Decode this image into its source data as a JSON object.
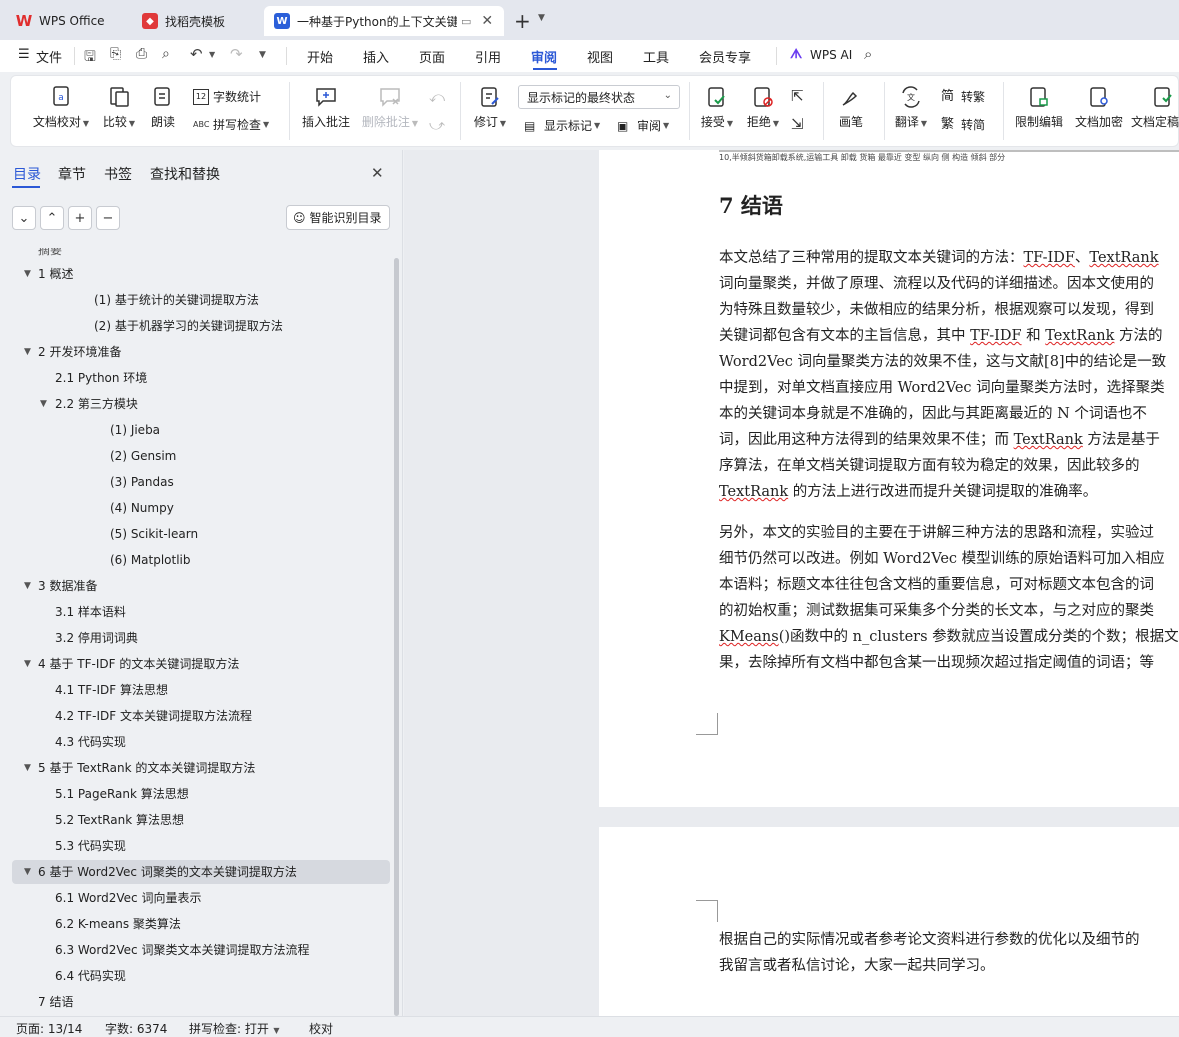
{
  "tabs": {
    "wps": "WPS Office",
    "template": "找稻壳模板",
    "doc": "一种基于Python的上下文关键"
  },
  "menu": {
    "file": "文件",
    "items": [
      "开始",
      "插入",
      "页面",
      "引用",
      "审阅",
      "视图",
      "工具",
      "会员专享"
    ],
    "ai": "WPS AI"
  },
  "ribbon": {
    "proofread": "文档校对",
    "compare": "比较",
    "read_aloud": "朗读",
    "word_count": "字数统计",
    "spell_check": "拼写检查",
    "insert_comment": "插入批注",
    "delete_comment": "删除批注",
    "track_changes": "修订",
    "markup_state": "显示标记的最终状态",
    "show_markup": "显示标记",
    "review": "审阅",
    "accept": "接受",
    "reject": "拒绝",
    "pen": "画笔",
    "translate": "翻译",
    "to_traditional": "转繁",
    "to_simplified": "转简",
    "restrict_edit": "限制编辑",
    "encrypt": "文档加密",
    "finalize": "文档定稿"
  },
  "sidebar": {
    "tabs": [
      "目录",
      "章节",
      "书签",
      "查找和替换"
    ],
    "ai_toc": "智能识别目录",
    "toc": [
      {
        "text": "摘要"
      },
      {
        "text": "1  概述"
      },
      {
        "text": "(1)  基于统计的关键词提取方法"
      },
      {
        "text": "(2)  基于机器学习的关键词提取方法"
      },
      {
        "text": "2  开发环境准备"
      },
      {
        "text": "2.1 Python 环境"
      },
      {
        "text": "2.2  第三方模块"
      },
      {
        "text": "(1)  Jieba"
      },
      {
        "text": "(2)  Gensim"
      },
      {
        "text": "(3)  Pandas"
      },
      {
        "text": "(4)  Numpy"
      },
      {
        "text": "(5)  Scikit-learn"
      },
      {
        "text": "(6)  Matplotlib"
      },
      {
        "text": "3  数据准备"
      },
      {
        "text": "3.1  样本语料"
      },
      {
        "text": "3.2  停用词词典"
      },
      {
        "text": "4  基于 TF-IDF 的文本关键词提取方法"
      },
      {
        "text": "4.1 TF-IDF 算法思想"
      },
      {
        "text": "4.2 TF-IDF 文本关键词提取方法流程"
      },
      {
        "text": "4.3  代码实现"
      },
      {
        "text": "5  基于 TextRank 的文本关键词提取方法"
      },
      {
        "text": "5.1 PageRank 算法思想"
      },
      {
        "text": "5.2 TextRank 算法思想"
      },
      {
        "text": "5.3  代码实现"
      },
      {
        "text": "6  基于 Word2Vec 词聚类的文本关键词提取方法"
      },
      {
        "text": "6.1 Word2Vec 词向量表示"
      },
      {
        "text": "6.2 K-means 聚类算法"
      },
      {
        "text": "6.3 Word2Vec 词聚类文本关键词提取方法流程"
      },
      {
        "text": "6.4  代码实现"
      },
      {
        "text": "7  结语"
      }
    ]
  },
  "document": {
    "top_snippet": "10,半倾斜货箱卸载系统,运输工具 卸载 货箱 最靠近 变型 纵向 侧 构造 倾斜 部分",
    "heading": "7  结语",
    "para1": [
      "本文总结了三种常用的提取文本关键词的方法：TF-IDF、TextRank",
      "词向量聚类，并做了原理、流程以及代码的详细描述。因本文使用的",
      "为特殊且数量较少，未做相应的结果分析，根据观察可以发现，得到",
      "关键词都包含有文本的主旨信息，其中 TF-IDF 和 TextRank 方法的",
      "Word2Vec 词向量聚类方法的效果不佳，这与文献[8]中的结论是一致",
      "中提到，对单文档直接应用 Word2Vec 词向量聚类方法时，选择聚类",
      "本的关键词本身就是不准确的，因此与其距离最近的 N 个词语也不",
      "词，因此用这种方法得到的结果效果不佳；而 TextRank 方法是基于",
      "序算法，在单文档关键词提取方面有较为稳定的效果，因此较多的",
      "TextRank 的方法上进行改进而提升关键词提取的准确率。"
    ],
    "para2": [
      "另外，本文的实验目的主要在于讲解三种方法的思路和流程，实验过",
      "细节仍然可以改进。例如 Word2Vec 模型训练的原始语料可加入相应",
      "本语料；标题文本往往包含文档的重要信息，可对标题文本包含的词",
      "的初始权重；测试数据集可采集多个分类的长文本，与之对应的聚类",
      "KMeans()函数中的 n_clusters 参数就应当设置成分类的个数；根据文",
      "果，去除掉所有文档中都包含某一出现频次超过指定阈值的词语；等"
    ],
    "para3": [
      "根据自己的实际情况或者参考论文资料进行参数的优化以及细节的",
      "我留言或者私信讨论，大家一起共同学习。"
    ]
  },
  "status": {
    "page": "页面: 13/14",
    "words": "字数: 6374",
    "spell": "拼写检查: 打开",
    "proof": "校对"
  },
  "colors": {
    "accent": "#2b58d6",
    "wps_red": "#e02d2d",
    "doc_blue": "#2b5fd9"
  }
}
